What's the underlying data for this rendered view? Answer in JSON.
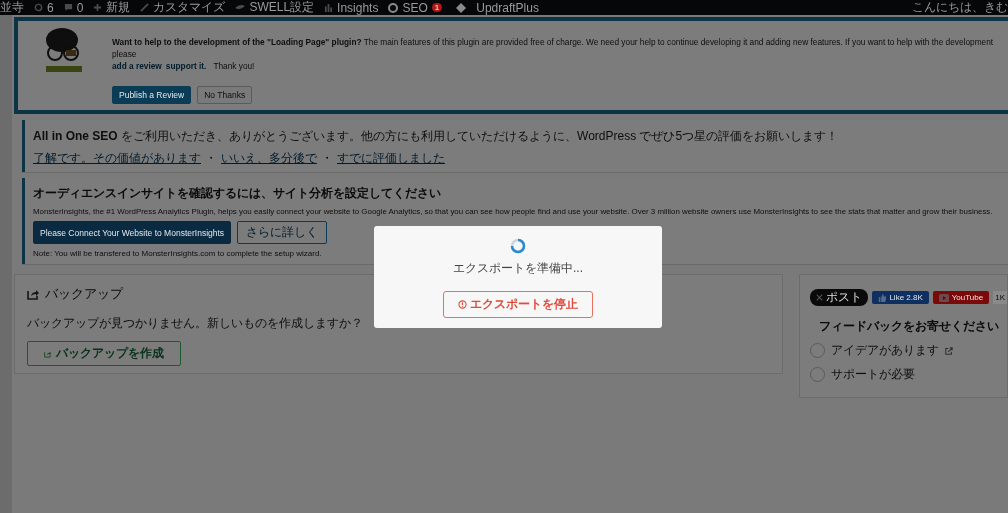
{
  "admin_bar": {
    "site": "並寺",
    "updates": "6",
    "comments": "0",
    "items": [
      {
        "label": "新規"
      },
      {
        "label": "カスタマイズ"
      },
      {
        "label": "SWELL設定"
      },
      {
        "label": "Insights"
      },
      {
        "label": "SEO",
        "badge": "1"
      },
      {
        "label": "UpdraftPlus"
      }
    ],
    "greeting": "こんにちは、きむ"
  },
  "loading_notice": {
    "message": "**Want to help to the development of the \"Loading Page\" plugin?** The main features of this plugin are provided free of charge. We need your help to continue developing it and adding new features. If you want to help with the development please",
    "link": "add a review",
    "link2": "support it.",
    "thanks": "Thank you!",
    "buttons": [
      {
        "label": "Publish a Review",
        "kind": "primary"
      },
      {
        "label": "No Thanks",
        "kind": "secondary"
      }
    ]
  },
  "seo_notice": {
    "message": "**All in One SEO** をご利用いただき、ありがとうございます。他の方にも利用していただけるように、WordPress でぜひ5つ星の評価をお願いします！",
    "links": [
      "了解です。その価値があります",
      "いいえ、多分後で",
      "すでに評価しました"
    ],
    "separator": "・"
  },
  "insights_notice": {
    "title": "オーディエンスインサイトを確認するには、サイト分析を設定してください",
    "message": "MonsterInsights, the #1 WordPress Analytics Plugin, helps you easily connect your website to Google Analytics, so that you can see how people find and use your website. Over 3 million website owners use MonsterInsights to see the stats that matter and grow their business.",
    "buttons": [
      {
        "label": "Please Connect Your Website to MonsterInsights",
        "kind": "primary"
      },
      {
        "label": "さらに詳しく",
        "kind": "secondary"
      }
    ],
    "note": "Note: You will be transfered to MonsterInsights.com to complete the setup wizard."
  },
  "backup": {
    "title": "バックアップ",
    "message": "バックアップが見つかりません。新しいものを作成しますか？",
    "button": "バックアップを作成"
  },
  "sidebar": {
    "social": {
      "post": "ポスト",
      "like": "Like 2.8K",
      "youtube": "YouTube",
      "youtube_count": "1K"
    },
    "feedback_title": "フィードバックをお寄せください",
    "options": [
      {
        "label": "アイデアがあります",
        "external": true,
        "selected": false
      },
      {
        "label": "サポートが必要",
        "external": false,
        "selected": false
      }
    ]
  },
  "modal": {
    "message": "エクスポートを準備中...",
    "button": "エクスポートを停止"
  }
}
